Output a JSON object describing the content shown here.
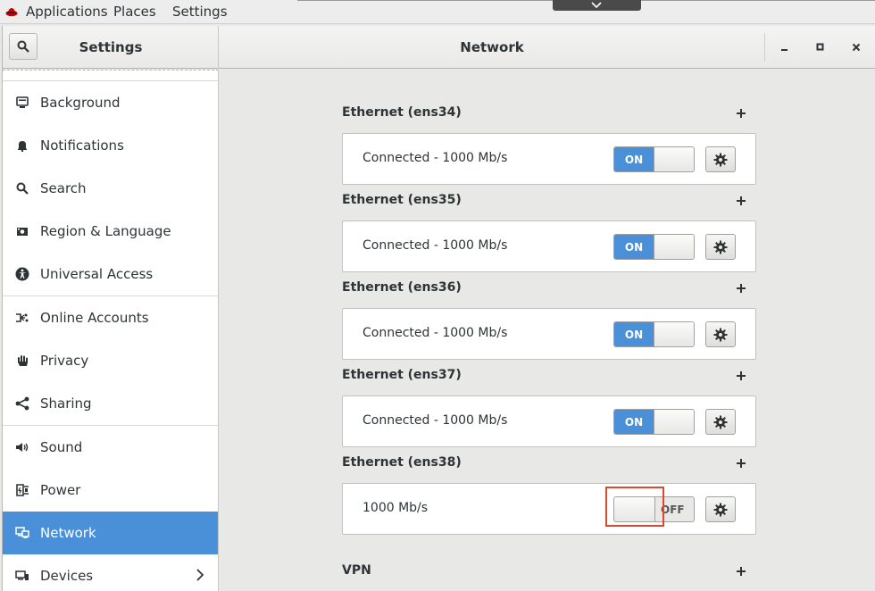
{
  "topbar": {
    "menus": [
      "Applications",
      "Places",
      "Settings"
    ]
  },
  "window": {
    "sidebar_title": "Settings",
    "panel_title": "Network"
  },
  "sidebar": {
    "items": [
      {
        "label": "Background",
        "icon": "background-icon"
      },
      {
        "label": "Notifications",
        "icon": "bell-icon"
      },
      {
        "label": "Search",
        "icon": "search-icon"
      },
      {
        "label": "Region & Language",
        "icon": "region-icon"
      },
      {
        "label": "Universal Access",
        "icon": "accessibility-icon"
      },
      {
        "label": "Online Accounts",
        "icon": "online-accounts-icon"
      },
      {
        "label": "Privacy",
        "icon": "hand-icon"
      },
      {
        "label": "Sharing",
        "icon": "share-icon"
      },
      {
        "label": "Sound",
        "icon": "speaker-icon"
      },
      {
        "label": "Power",
        "icon": "power-icon"
      },
      {
        "label": "Network",
        "icon": "network-icon",
        "active": true
      },
      {
        "label": "Devices",
        "icon": "devices-icon"
      }
    ]
  },
  "network": {
    "connections": [
      {
        "title": "Ethernet (ens34)",
        "status": "Connected - 1000 Mb/s",
        "switch": "ON"
      },
      {
        "title": "Ethernet (ens35)",
        "status": "Connected - 1000 Mb/s",
        "switch": "ON"
      },
      {
        "title": "Ethernet (ens36)",
        "status": "Connected - 1000 Mb/s",
        "switch": "ON"
      },
      {
        "title": "Ethernet (ens37)",
        "status": "Connected - 1000 Mb/s",
        "switch": "ON"
      },
      {
        "title": "Ethernet (ens38)",
        "status": "1000 Mb/s",
        "switch": "OFF"
      }
    ],
    "vpn_title": "VPN"
  },
  "colors": {
    "accent": "#4a90d9",
    "highlight": "#e0472f"
  }
}
